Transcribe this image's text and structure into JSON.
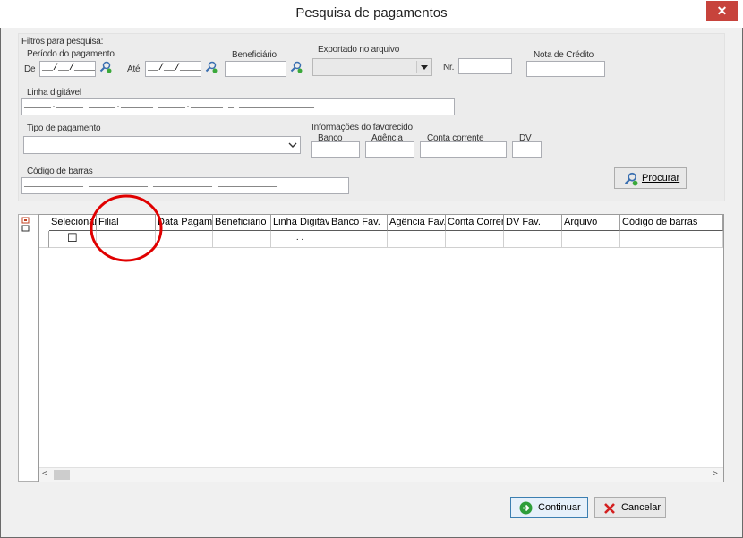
{
  "window": {
    "title": "Pesquisa de pagamentos",
    "close_symbol": "✕"
  },
  "filters": {
    "group_label": "Filtros para pesquisa:",
    "period_label": "Período do pagamento",
    "from_label": "De",
    "from_value": "__/__/____",
    "to_label": "Até",
    "to_value": "__/__/____",
    "beneficiary_label": "Beneficiário",
    "beneficiary_value": "",
    "exported_label": "Exportado no arquivo",
    "exported_value": "",
    "number_label": "Nr.",
    "number_value": "",
    "credit_note_label": "Nota de Crédito",
    "credit_note_value": "",
    "digital_line_label": "Linha digitável",
    "digital_line_value": "_____._____ _____.______ _____.______ _ ______________",
    "payment_type_label": "Tipo de pagamento",
    "payment_type_value": "",
    "payee_info_label": "Informações do favorecido",
    "bank_label": "Banco",
    "agency_label": "Agência",
    "account_label": "Conta corrente",
    "dv_label": "DV",
    "barcode_label": "Código de barras",
    "barcode_value": "___________ ___________ ___________ ___________",
    "search_button": "Procurar"
  },
  "grid": {
    "columns": [
      "Selecionar",
      "Filial",
      "Data Pagamento",
      "Beneficiário",
      "Linha Digitável",
      "Banco Fav.",
      "Agência Fav.",
      "Conta Corrente",
      "DV Fav.",
      "Arquivo",
      "Código de barras"
    ],
    "row": {
      "checkbox_symbol": "☐",
      "digital_line_cell": ". ."
    }
  },
  "scrollbar": {
    "left_arrow": "<",
    "right_arrow": ">"
  },
  "buttons": {
    "continue": "Continuar",
    "cancel": "Cancelar"
  },
  "colors": {
    "annotation_circle": "#e00000",
    "close_button": "#c7433c"
  }
}
